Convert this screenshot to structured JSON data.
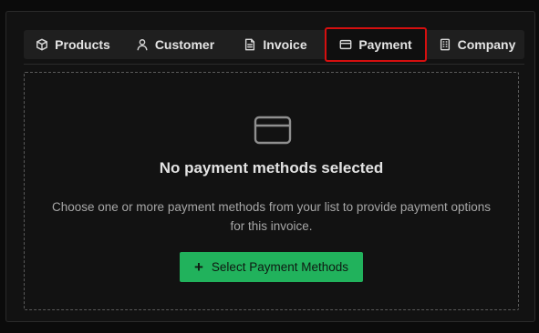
{
  "tabs": [
    {
      "label": "Products",
      "icon": "box-icon"
    },
    {
      "label": "Customer",
      "icon": "user-icon"
    },
    {
      "label": "Invoice",
      "icon": "document-icon"
    },
    {
      "label": "Payment",
      "icon": "credit-card-icon",
      "active": true
    },
    {
      "label": "Company",
      "icon": "building-icon"
    }
  ],
  "empty_state": {
    "icon": "credit-card-icon",
    "title": "No payment methods selected",
    "description": "Choose one or more payment methods from your list to provide payment options for this invoice.",
    "button_label": "Select Payment Methods",
    "button_icon": "plus-icon"
  },
  "colors": {
    "accent": "#21b25c",
    "highlight": "#d50f0f",
    "background": "#121212"
  }
}
